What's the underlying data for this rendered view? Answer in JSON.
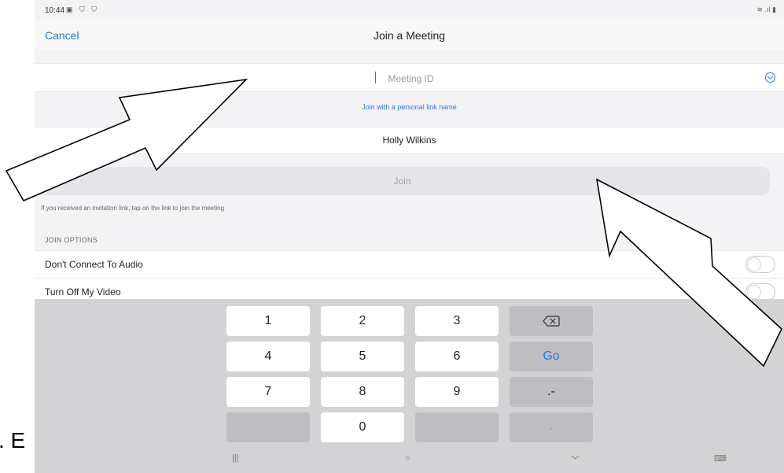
{
  "status": {
    "time": "10:44",
    "left_icons": "▣ ⛉ ⛉",
    "right_icons": "≋ .ıl ▮"
  },
  "header": {
    "cancel": "Cancel",
    "title": "Join a Meeting"
  },
  "form": {
    "meeting_id_placeholder": "Meeting ID",
    "personal_link": "Join with a personal link name",
    "name_value": "Holly Wilkins",
    "join_label": "Join",
    "hint": "If you received an invitation link, tap on the link to join the meeting"
  },
  "options": {
    "section_title": "JOIN OPTIONS",
    "items": [
      {
        "label": "Don't Connect To Audio",
        "enabled": false
      },
      {
        "label": "Turn Off My Video",
        "enabled": false
      }
    ]
  },
  "keyboard": {
    "keys": [
      "1",
      "2",
      "3",
      "4",
      "5",
      "6",
      "7",
      "8",
      "9",
      "0"
    ],
    "go": "Go",
    "dot_dash": ".-",
    "comma": ",",
    "nav": [
      "|||",
      "○",
      "﹀",
      "⌨"
    ]
  },
  "overlay_text": ". E",
  "colors": {
    "accent": "#2b78d6",
    "keyboard_bg": "#d3d3d6",
    "screen_bg": "#f3f3f5"
  }
}
